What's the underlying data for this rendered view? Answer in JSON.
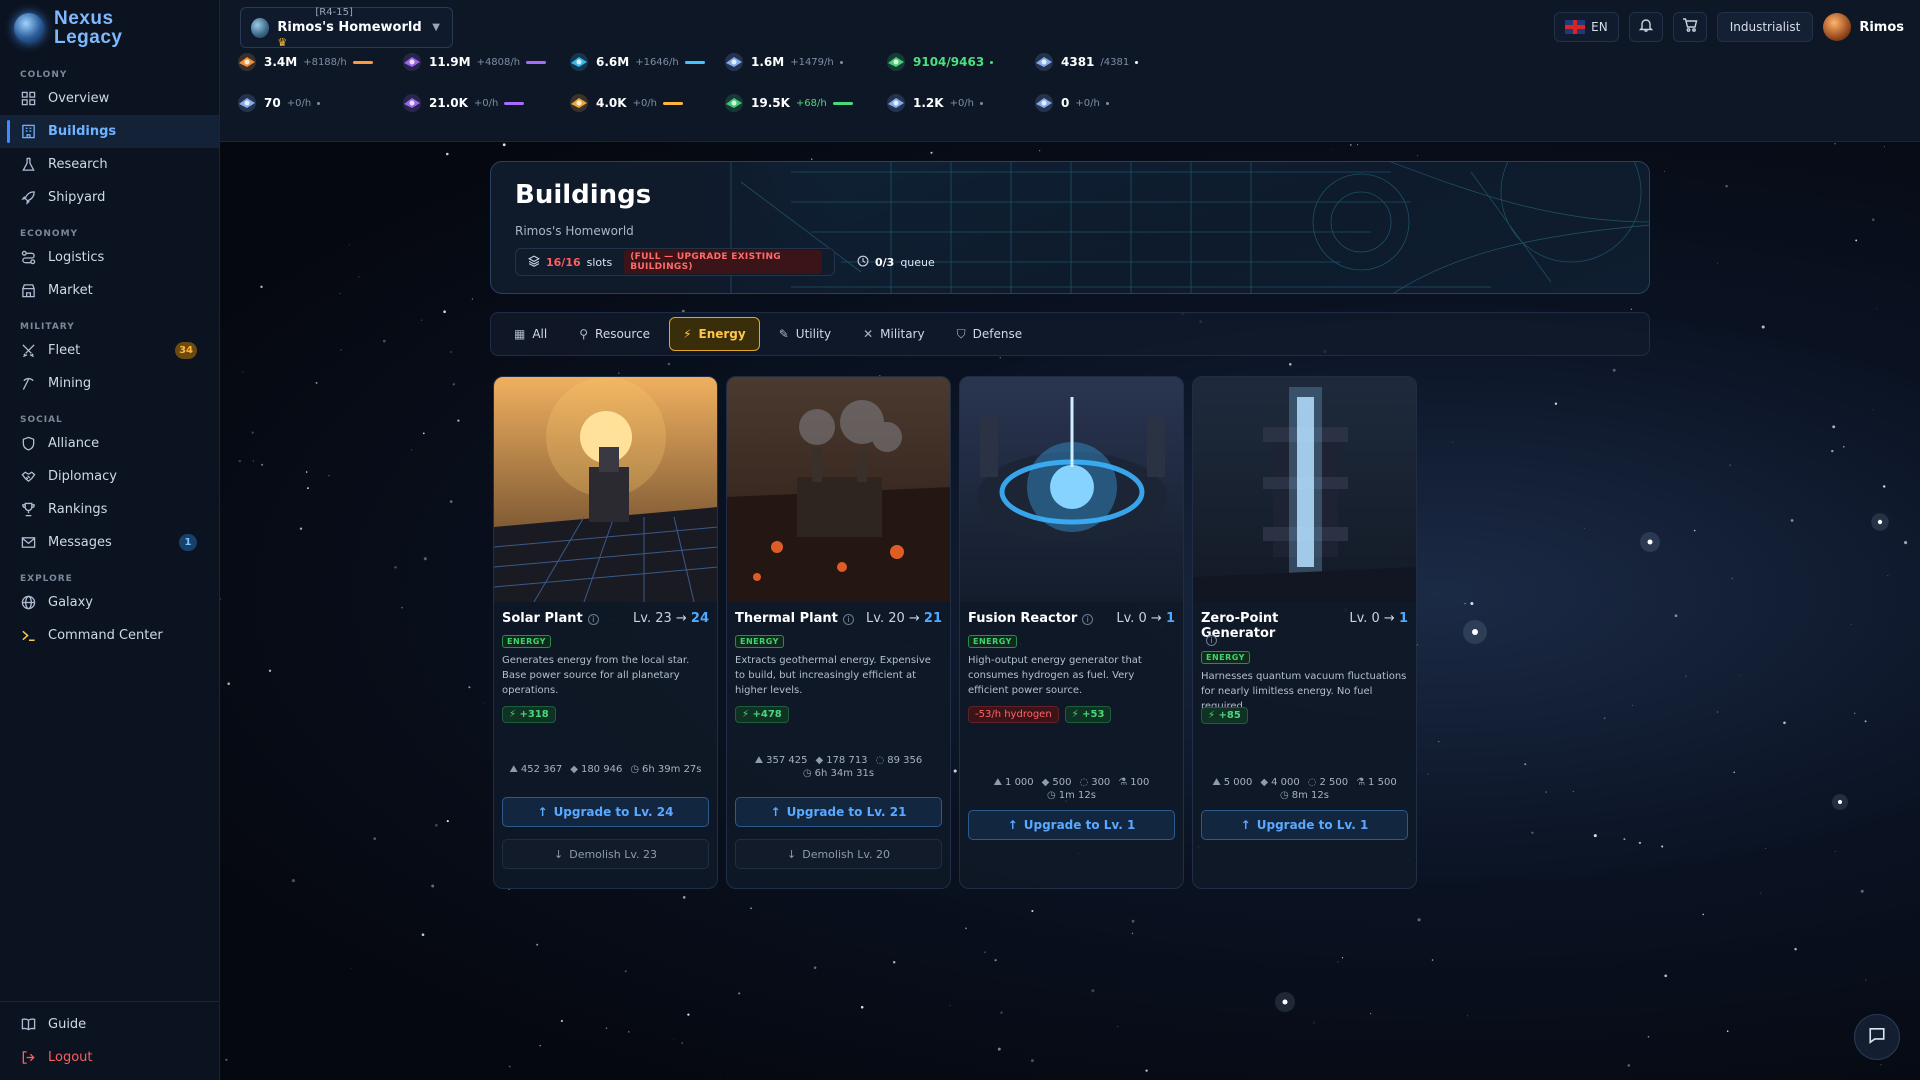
{
  "app": {
    "name_line1": "Nexus",
    "name_line2": "Legacy"
  },
  "sidebar": {
    "sections": {
      "colony": "COLONY",
      "economy": "ECONOMY",
      "military": "MILITARY",
      "social": "SOCIAL",
      "explore": "EXPLORE"
    },
    "items": {
      "overview": "Overview",
      "buildings": "Buildings",
      "research": "Research",
      "shipyard": "Shipyard",
      "logistics": "Logistics",
      "market": "Market",
      "fleet": "Fleet",
      "fleet_badge": "34",
      "mining": "Mining",
      "alliance": "Alliance",
      "diplomacy": "Diplomacy",
      "rankings": "Rankings",
      "messages": "Messages",
      "messages_badge": "1",
      "galaxy": "Galaxy",
      "command_center": "Command Center"
    },
    "bottom": {
      "guide": "Guide",
      "logout": "Logout"
    },
    "active": "buildings"
  },
  "topbar": {
    "planet": {
      "coords": "[R4-15]",
      "name": "Rimos's Homeworld"
    },
    "language": "EN",
    "rank": "Industrialist",
    "username": "Rimos"
  },
  "resources": {
    "row1": [
      {
        "icon": "ore-ship-icon",
        "value": "3.4M",
        "rate": "+8188/h",
        "color": "#ff9a3c",
        "bar": true
      },
      {
        "icon": "crystal-ship-icon",
        "value": "11.9M",
        "rate": "+4808/h",
        "color": "#a76bff",
        "bar": true
      },
      {
        "icon": "hydrogen-orb-icon",
        "value": "6.6M",
        "rate": "+1646/h",
        "color": "#3cc8ff",
        "bar": true
      },
      {
        "icon": "fighter-icon",
        "value": "1.6M",
        "rate": "+1479/h",
        "color": "#7f8da3",
        "bar": false
      },
      {
        "icon": "energy-core-icon",
        "value": "9104/9463",
        "rate": "",
        "color": "#49e07d",
        "bar": false
      },
      {
        "icon": "population-icon",
        "value": "4381",
        "rate": "/4381",
        "color": "#ffffff",
        "bar": false
      }
    ],
    "row2": [
      {
        "icon": "cruiser-icon",
        "value": "70",
        "rate": "+0/h",
        "color": "#7f8da3",
        "bar": false
      },
      {
        "icon": "jet-icon",
        "value": "21.0K",
        "rate": "+0/h",
        "color": "#a76bff",
        "bar": true
      },
      {
        "icon": "ember-orb-icon",
        "value": "4.0K",
        "rate": "+0/h",
        "color": "#ffb43c",
        "bar": true
      },
      {
        "icon": "bio-orb-icon",
        "value": "19.5K",
        "rate": "+68/h",
        "color": "#49d97a",
        "bar": true
      },
      {
        "icon": "void-ship-icon",
        "value": "1.2K",
        "rate": "+0/h",
        "color": "#7f8da3",
        "bar": false
      },
      {
        "icon": "ring-icon",
        "value": "0",
        "rate": "+0/h",
        "color": "#7f8da3",
        "bar": false
      }
    ]
  },
  "hero": {
    "title": "Buildings",
    "subtitle": "Rimos's Homeworld",
    "slots_value": "16/16",
    "slots_label": "slots",
    "slots_warning": "(FULL — UPGRADE EXISTING BUILDINGS)",
    "queue_value": "0/3",
    "queue_label": "queue"
  },
  "tabs": [
    {
      "label": "All",
      "icon": "grid-icon"
    },
    {
      "label": "Resource",
      "icon": "pickaxe-icon"
    },
    {
      "label": "Energy",
      "icon": "lightning-icon",
      "active": true
    },
    {
      "label": "Utility",
      "icon": "wrench-icon"
    },
    {
      "label": "Military",
      "icon": "swords-icon"
    },
    {
      "label": "Defense",
      "icon": "shield-icon"
    }
  ],
  "buildings": [
    {
      "name": "Solar Plant",
      "level": "Lv. 23",
      "next": "24",
      "tag": "ENERGY",
      "desc": "Generates energy from the local star. Base power source for all planetary operations.",
      "production": "+318",
      "consumption": "",
      "costs": [
        {
          "icon": "ore",
          "val": "452 367"
        },
        {
          "icon": "crystal",
          "val": "180 946"
        },
        {
          "icon": "clock",
          "val": "6h 39m 27s"
        }
      ],
      "upgrade": "Upgrade to Lv. 24",
      "demolish": "Demolish Lv. 23",
      "accent": "#f5a623"
    },
    {
      "name": "Thermal Plant",
      "level": "Lv. 20",
      "next": "21",
      "tag": "ENERGY",
      "desc": "Extracts geothermal energy. Expensive to build, but increasingly efficient at higher levels.",
      "production": "+478",
      "consumption": "",
      "costs": [
        {
          "icon": "ore",
          "val": "357 425"
        },
        {
          "icon": "crystal",
          "val": "178 713"
        },
        {
          "icon": "hydrogen",
          "val": "89 356"
        },
        {
          "icon": "clock",
          "val": "6h 34m 31s"
        }
      ],
      "upgrade": "Upgrade to Lv. 21",
      "demolish": "Demolish Lv. 20",
      "accent": "#ff6a2a"
    },
    {
      "name": "Fusion Reactor",
      "level": "Lv. 0",
      "next": "1",
      "tag": "ENERGY",
      "desc": "High-output energy generator that consumes hydrogen as fuel. Very efficient power source.",
      "production": "+53",
      "consumption": "-53/h hydrogen",
      "costs": [
        {
          "icon": "ore",
          "val": "1 000"
        },
        {
          "icon": "crystal",
          "val": "500"
        },
        {
          "icon": "hydrogen",
          "val": "300"
        },
        {
          "icon": "flask",
          "val": "100"
        },
        {
          "icon": "clock",
          "val": "1m 12s"
        }
      ],
      "upgrade": "Upgrade to Lv. 1",
      "demolish": "",
      "accent": "#3cb4ff"
    },
    {
      "name": "Zero-Point Generator",
      "level": "Lv. 0",
      "next": "1",
      "tag": "ENERGY",
      "desc": "Harnesses quantum vacuum fluctuations for nearly limitless energy. No fuel required.",
      "production": "+85",
      "consumption": "",
      "costs": [
        {
          "icon": "ore",
          "val": "5 000"
        },
        {
          "icon": "crystal",
          "val": "4 000"
        },
        {
          "icon": "hydrogen",
          "val": "2 500"
        },
        {
          "icon": "flask",
          "val": "1 500"
        },
        {
          "icon": "clock",
          "val": "8m 12s"
        }
      ],
      "upgrade": "Upgrade to Lv. 1",
      "demolish": "",
      "accent": "#8fd0ff"
    }
  ]
}
